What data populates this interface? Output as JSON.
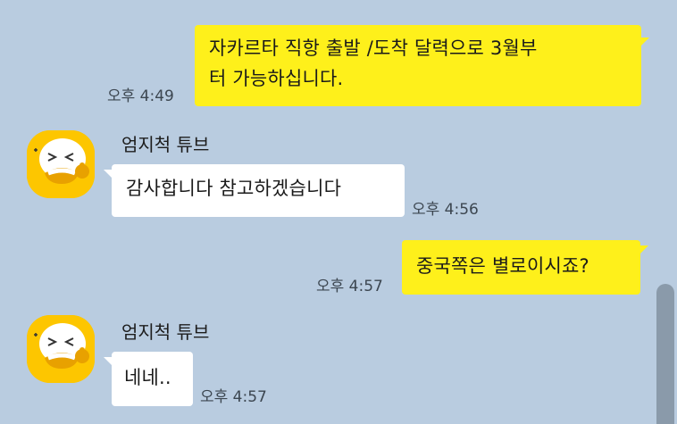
{
  "messages": [
    {
      "direction": "sent",
      "lines": [
        "자카르타 직항 출발 /도착 달력으로 3월부",
        "터 가능하십니다."
      ],
      "time": "오후 4:49"
    },
    {
      "direction": "received",
      "sender": "엄지척 튜브",
      "text": "감사합니다 참고하겠습니다",
      "time": "오후 4:56"
    },
    {
      "direction": "sent",
      "text": "중국쪽은 별로이시죠?",
      "time": "오후 4:57"
    },
    {
      "direction": "received",
      "sender": "엄지척 튜브",
      "text": "네네..",
      "time": "오후 4:57"
    }
  ],
  "colors": {
    "background": "#b9cce0",
    "sent_bubble": "#fef01b",
    "received_bubble": "#ffffff",
    "avatar": "#fdc600"
  },
  "icons": {
    "avatar": "emoticon-thumbs-up-avatar",
    "scrollbar": "scrollbar-thumb"
  }
}
